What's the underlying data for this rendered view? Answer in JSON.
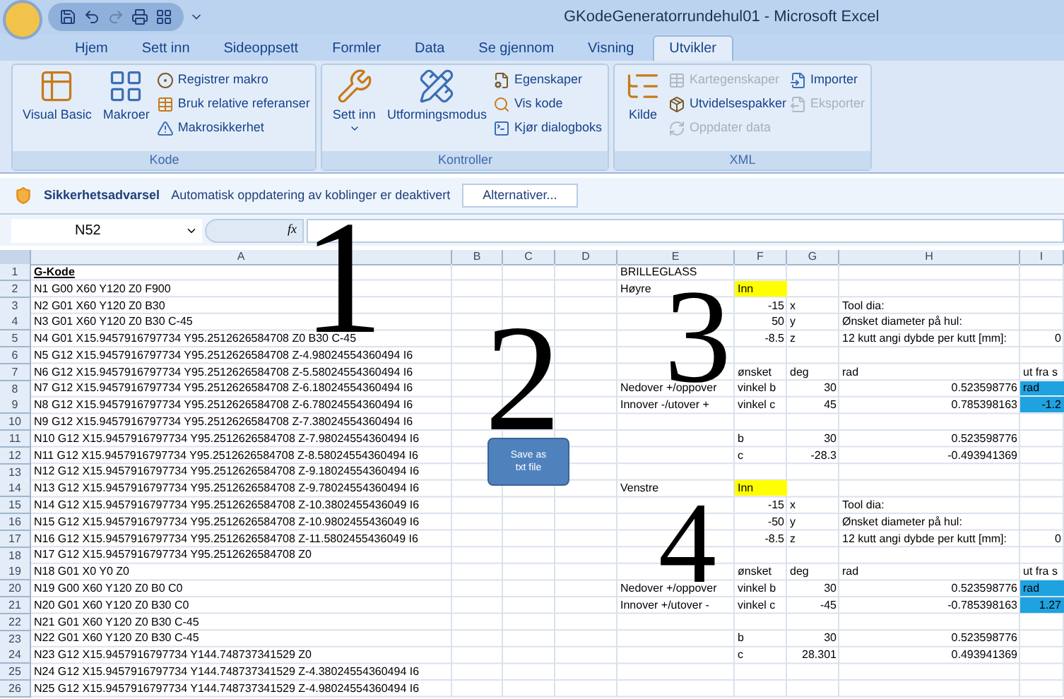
{
  "window": {
    "title": "GKodeGeneratorrundehul01 - Microsoft Excel"
  },
  "tabs": [
    {
      "label": "Hjem",
      "selected": false
    },
    {
      "label": "Sett inn",
      "selected": false
    },
    {
      "label": "Sideoppsett",
      "selected": false
    },
    {
      "label": "Formler",
      "selected": false
    },
    {
      "label": "Data",
      "selected": false
    },
    {
      "label": "Se gjennom",
      "selected": false
    },
    {
      "label": "Visning",
      "selected": false
    },
    {
      "label": "Utvikler",
      "selected": true
    }
  ],
  "ribbon": {
    "groups": [
      {
        "label": "Kode",
        "items": [
          {
            "kind": "large",
            "label": "Visual Basic",
            "disabled": false
          },
          {
            "kind": "large",
            "label": "Makroer",
            "disabled": false
          },
          {
            "kind": "small",
            "label": "Registrer makro",
            "disabled": false
          },
          {
            "kind": "small",
            "label": "Bruk relative referanser",
            "disabled": false
          },
          {
            "kind": "small",
            "label": "Makrosikkerhet",
            "disabled": false
          }
        ]
      },
      {
        "label": "Kontroller",
        "items": [
          {
            "kind": "menu",
            "label": "Sett inn",
            "disabled": false
          },
          {
            "kind": "large",
            "label": "Utformingsmodus",
            "disabled": false
          },
          {
            "kind": "small",
            "label": "Egenskaper",
            "disabled": false
          },
          {
            "kind": "small",
            "label": "Vis kode",
            "disabled": false
          },
          {
            "kind": "small",
            "label": "Kjør dialogboks",
            "disabled": false
          }
        ]
      },
      {
        "label": "XML",
        "items": [
          {
            "kind": "large",
            "label": "Kilde",
            "disabled": false
          },
          {
            "kind": "small",
            "label": "Kartegenskaper",
            "disabled": true
          },
          {
            "kind": "small",
            "label": "Utvidelsespakker",
            "disabled": false
          },
          {
            "kind": "small",
            "label": "Oppdater data",
            "disabled": true
          },
          {
            "kind": "small",
            "label": "Importer",
            "disabled": false
          },
          {
            "kind": "small",
            "label": "Eksporter",
            "disabled": true
          }
        ]
      }
    ]
  },
  "security_bar": {
    "title": "Sikkerhetsadvarsel",
    "message": "Automatisk oppdatering av koblinger er deaktivert",
    "button": "Alternativer..."
  },
  "formula_bar": {
    "name_box": "N52",
    "function_label": "fx"
  },
  "sheet": {
    "columns": [
      "A",
      "B",
      "C",
      "D",
      "E",
      "F",
      "G",
      "H",
      "I"
    ],
    "rows": [
      {
        "number": "1",
        "A": {
          "text": "G-Kode",
          "kind": "heading"
        },
        "E": {
          "text": "BRILLEGLASS",
          "kind": "text"
        }
      },
      {
        "number": "2",
        "A": {
          "text": "N1 G00 X60 Y120 Z0 F900",
          "kind": "text"
        },
        "E": {
          "text": "Høyre",
          "kind": "text"
        },
        "F": {
          "text": "Inn",
          "kind": "text",
          "color": "#ffff00"
        }
      },
      {
        "number": "3",
        "A": {
          "text": "N2 G01 X60 Y120 Z0 B30",
          "kind": "text"
        },
        "F": {
          "text": "-15",
          "kind": "number"
        },
        "G": {
          "text": "x",
          "kind": "text"
        },
        "H": {
          "text": "Tool dia:",
          "kind": "text"
        }
      },
      {
        "number": "4",
        "A": {
          "text": "N3 G01 X60 Y120 Z0 B30 C-45",
          "kind": "text"
        },
        "F": {
          "text": "50",
          "kind": "number"
        },
        "G": {
          "text": "y",
          "kind": "text"
        },
        "H": {
          "text": "Ønsket diameter på hul:",
          "kind": "text"
        }
      },
      {
        "number": "5",
        "A": {
          "text": "N4 G01 X15.9457916797734 Y95.2512626584708 Z0 B30 C-45",
          "kind": "text"
        },
        "F": {
          "text": "-8.5",
          "kind": "number"
        },
        "G": {
          "text": "z",
          "kind": "text"
        },
        "H": {
          "text": "12 kutt angi dybde per kutt [mm]:",
          "kind": "text"
        },
        "I": {
          "text": "0",
          "kind": "number"
        }
      },
      {
        "number": "6",
        "A": {
          "text": "N5 G12 X15.9457916797734 Y95.2512626584708 Z-4.98024554360494 I6",
          "kind": "text"
        }
      },
      {
        "number": "7",
        "A": {
          "text": "N6 G12 X15.9457916797734 Y95.2512626584708 Z-5.58024554360494 I6",
          "kind": "text"
        },
        "F": {
          "text": "ønsket",
          "kind": "text"
        },
        "G": {
          "text": "deg",
          "kind": "text"
        },
        "H": {
          "text": "rad",
          "kind": "text"
        },
        "I": {
          "text": "ut fra s",
          "kind": "text"
        }
      },
      {
        "number": "8",
        "A": {
          "text": "N7 G12 X15.9457916797734 Y95.2512626584708 Z-6.18024554360494 I6",
          "kind": "text"
        },
        "E": {
          "text": "Nedover +/oppover",
          "kind": "text"
        },
        "F": {
          "text": "vinkel b",
          "kind": "text"
        },
        "G": {
          "text": "30",
          "kind": "number"
        },
        "H": {
          "text": "0.523598776",
          "kind": "number"
        },
        "I": {
          "text": "rad",
          "kind": "text",
          "color": "#1fa2e0"
        }
      },
      {
        "number": "9",
        "A": {
          "text": "N8 G12 X15.9457916797734 Y95.2512626584708 Z-6.78024554360494 I6",
          "kind": "text"
        },
        "E": {
          "text": "Innover -/utover +",
          "kind": "text"
        },
        "F": {
          "text": "vinkel c",
          "kind": "text"
        },
        "G": {
          "text": "45",
          "kind": "number"
        },
        "H": {
          "text": "0.785398163",
          "kind": "number"
        },
        "I": {
          "text": "-1.2",
          "kind": "number",
          "color": "#1fa2e0"
        }
      },
      {
        "number": "10",
        "A": {
          "text": "N9 G12 X15.9457916797734 Y95.2512626584708 Z-7.38024554360494 I6",
          "kind": "text"
        }
      },
      {
        "number": "11",
        "A": {
          "text": "N10 G12 X15.9457916797734 Y95.2512626584708 Z-7.98024554360494 I6",
          "kind": "text"
        },
        "F": {
          "text": "b",
          "kind": "text"
        },
        "G": {
          "text": "30",
          "kind": "number"
        },
        "H": {
          "text": "0.523598776",
          "kind": "number"
        }
      },
      {
        "number": "12",
        "A": {
          "text": "N11 G12 X15.9457916797734 Y95.2512626584708 Z-8.58024554360494 I6",
          "kind": "text"
        },
        "F": {
          "text": "c",
          "kind": "text"
        },
        "G": {
          "text": "-28.3",
          "kind": "number"
        },
        "H": {
          "text": "-0.493941369",
          "kind": "number"
        }
      },
      {
        "number": "13",
        "A": {
          "text": "N12 G12 X15.9457916797734 Y95.2512626584708 Z-9.18024554360494 I6",
          "kind": "text"
        }
      },
      {
        "number": "14",
        "A": {
          "text": "N13 G12 X15.9457916797734 Y95.2512626584708 Z-9.78024554360494 I6",
          "kind": "text"
        },
        "E": {
          "text": "Venstre",
          "kind": "text"
        },
        "F": {
          "text": "Inn",
          "kind": "text",
          "color": "#ffff00"
        }
      },
      {
        "number": "15",
        "A": {
          "text": "N14 G12 X15.9457916797734 Y95.2512626584708 Z-10.3802455436049 I6",
          "kind": "text"
        },
        "F": {
          "text": "-15",
          "kind": "number"
        },
        "G": {
          "text": "x",
          "kind": "text"
        },
        "H": {
          "text": "Tool dia:",
          "kind": "text"
        }
      },
      {
        "number": "16",
        "A": {
          "text": "N15 G12 X15.9457916797734 Y95.2512626584708 Z-10.9802455436049 I6",
          "kind": "text"
        },
        "F": {
          "text": "-50",
          "kind": "number"
        },
        "G": {
          "text": "y",
          "kind": "text"
        },
        "H": {
          "text": "Ønsket diameter på hul:",
          "kind": "text"
        }
      },
      {
        "number": "17",
        "A": {
          "text": "N16 G12 X15.9457916797734 Y95.2512626584708 Z-11.5802455436049 I6",
          "kind": "text"
        },
        "F": {
          "text": "-8.5",
          "kind": "number"
        },
        "G": {
          "text": "z",
          "kind": "text"
        },
        "H": {
          "text": "12 kutt angi dybde per kutt [mm]:",
          "kind": "text"
        },
        "I": {
          "text": "0",
          "kind": "number"
        }
      },
      {
        "number": "18",
        "A": {
          "text": "N17 G12 X15.9457916797734 Y95.2512626584708 Z0",
          "kind": "text"
        }
      },
      {
        "number": "19",
        "A": {
          "text": "N18 G01 X0 Y0 Z0",
          "kind": "text"
        },
        "F": {
          "text": "ønsket",
          "kind": "text"
        },
        "G": {
          "text": "deg",
          "kind": "text"
        },
        "H": {
          "text": "rad",
          "kind": "text"
        },
        "I": {
          "text": "ut fra s",
          "kind": "text"
        }
      },
      {
        "number": "20",
        "A": {
          "text": "N19 G00 X60 Y120 Z0 B0 C0",
          "kind": "text"
        },
        "E": {
          "text": "Nedover +/oppover",
          "kind": "text"
        },
        "F": {
          "text": "vinkel b",
          "kind": "text"
        },
        "G": {
          "text": "30",
          "kind": "number"
        },
        "H": {
          "text": "0.523598776",
          "kind": "number"
        },
        "I": {
          "text": "rad",
          "kind": "text",
          "color": "#1fa2e0"
        }
      },
      {
        "number": "21",
        "A": {
          "text": "N20 G01 X60 Y120 Z0 B30 C0",
          "kind": "text"
        },
        "E": {
          "text": "Innover +/utover -",
          "kind": "text"
        },
        "F": {
          "text": "vinkel c",
          "kind": "text"
        },
        "G": {
          "text": "-45",
          "kind": "number"
        },
        "H": {
          "text": "-0.785398163",
          "kind": "number"
        },
        "I": {
          "text": "1.27",
          "kind": "number",
          "color": "#1fa2e0"
        }
      },
      {
        "number": "22",
        "A": {
          "text": "N21 G01 X60 Y120 Z0 B30 C-45",
          "kind": "text"
        }
      },
      {
        "number": "23",
        "A": {
          "text": "N22 G01 X60 Y120 Z0 B30 C-45",
          "kind": "text"
        },
        "F": {
          "text": "b",
          "kind": "text"
        },
        "G": {
          "text": "30",
          "kind": "number"
        },
        "H": {
          "text": "0.523598776",
          "kind": "number"
        }
      },
      {
        "number": "24",
        "A": {
          "text": "N23 G12 X15.9457916797734 Y144.748737341529 Z0",
          "kind": "text"
        },
        "F": {
          "text": "c",
          "kind": "text"
        },
        "G": {
          "text": "28.301",
          "kind": "number"
        },
        "H": {
          "text": "0.493941369",
          "kind": "number"
        }
      },
      {
        "number": "25",
        "A": {
          "text": "N24 G12 X15.9457916797734 Y144.748737341529 Z-4.38024554360494 I6",
          "kind": "text"
        }
      },
      {
        "number": "26",
        "A": {
          "text": "N25 G12 X15.9457916797734 Y144.748737341529 Z-4.98024554360494 I6",
          "kind": "text"
        }
      }
    ]
  },
  "save_button": {
    "label": "Save as txt file"
  },
  "annotations": [
    {
      "text": "1"
    },
    {
      "text": "2"
    },
    {
      "text": "3"
    },
    {
      "text": "4"
    }
  ]
}
